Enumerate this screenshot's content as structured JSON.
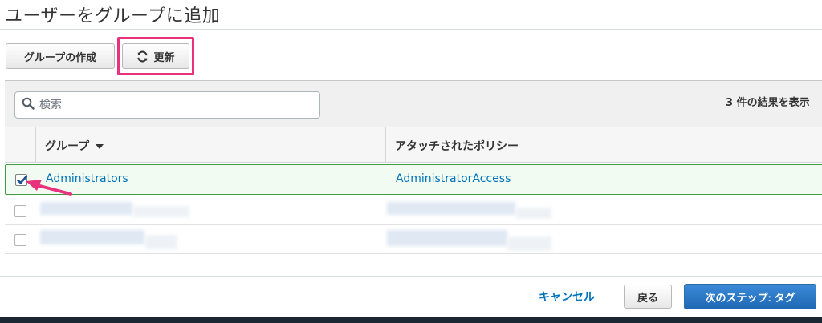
{
  "page": {
    "title": "ユーザーをグループに追加"
  },
  "toolbar": {
    "create_group_label": "グループの作成",
    "refresh_label": "更新"
  },
  "search": {
    "placeholder": "検索",
    "results_count": "3 件の結果を表示"
  },
  "table": {
    "columns": [
      {
        "label": "グループ",
        "sortable": true
      },
      {
        "label": "アタッチされたポリシー"
      }
    ],
    "rows": [
      {
        "group": "Administrators",
        "policy": "AdministratorAccess",
        "checked": true
      },
      {
        "group": "",
        "policy": "",
        "checked": false,
        "redacted": true
      },
      {
        "group": "",
        "policy": "",
        "checked": false,
        "redacted": true
      }
    ]
  },
  "footer": {
    "cancel_label": "キャンセル",
    "back_label": "戻る",
    "next_label": "次のステップ: タグ"
  },
  "colors": {
    "accent": "#e8327d",
    "link": "#0073bb",
    "selected_border": "#3f9c3f",
    "primary_button": "#2a78c8"
  },
  "icons": {
    "refresh": "refresh-icon",
    "search": "search-icon",
    "sort": "caret-down-icon",
    "check": "checkmark-icon"
  }
}
